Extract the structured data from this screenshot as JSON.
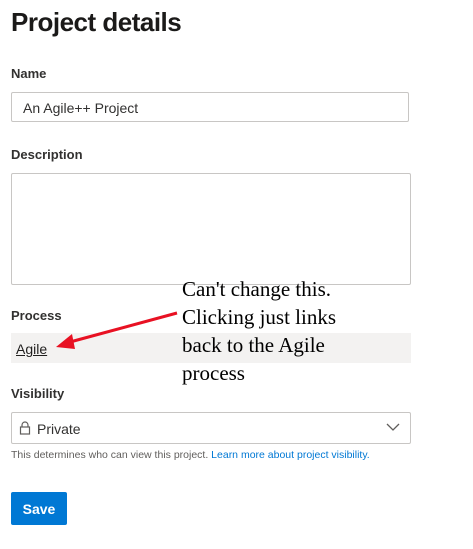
{
  "page": {
    "title": "Project details"
  },
  "name": {
    "label": "Name",
    "value": "An Agile++ Project"
  },
  "description": {
    "label": "Description",
    "value": ""
  },
  "process": {
    "label": "Process",
    "value": "Agile"
  },
  "visibility": {
    "label": "Visibility",
    "value": "Private",
    "help_text": "This determines who can view this project.",
    "help_link": "Learn more about project visibility."
  },
  "save_button": {
    "label": "Save"
  },
  "annotation": {
    "lines": [
      "Can't change this.",
      "Clicking just links",
      "back to the Agile",
      "process"
    ],
    "arrow_color": "#e81123"
  },
  "colors": {
    "accent": "#0078d4",
    "link": "#0078d4",
    "process_bg": "#f3f2f1"
  }
}
